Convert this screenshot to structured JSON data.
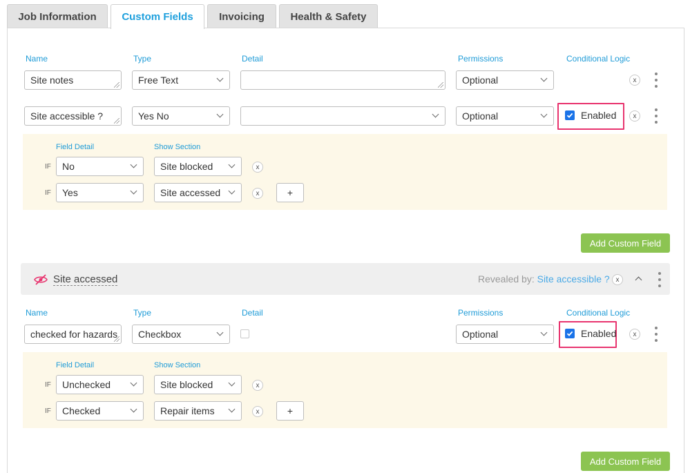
{
  "tabs": [
    "Job Information",
    "Custom Fields",
    "Invoicing",
    "Health & Safety"
  ],
  "columns": {
    "name": "Name",
    "type": "Type",
    "detail": "Detail",
    "permissions": "Permissions",
    "conditional": "Conditional Logic"
  },
  "fields": [
    {
      "name": "Site notes",
      "type": "Free Text",
      "detail": "",
      "permission": "Optional"
    },
    {
      "name": "Site accessible ?",
      "type": "Yes No",
      "detail": "",
      "permission": "Optional",
      "conditional_label": "Enabled"
    }
  ],
  "conditions1": {
    "field_detail_label": "Field Detail",
    "show_section_label": "Show Section",
    "if_label": "IF",
    "rows": [
      {
        "detail": "No",
        "section": "Site blocked"
      },
      {
        "detail": "Yes",
        "section": "Site accessed"
      }
    ],
    "add_label": "+"
  },
  "add_custom_field_label": "Add Custom Field",
  "section": {
    "title": "Site accessed",
    "revealed_by_label": "Revealed by:",
    "revealed_by_field": "Site accessible ?"
  },
  "section_fields": [
    {
      "name": "checked for hazards",
      "type": "Checkbox",
      "permission": "Optional",
      "conditional_label": "Enabled"
    }
  ],
  "conditions2": {
    "field_detail_label": "Field Detail",
    "show_section_label": "Show Section",
    "if_label": "IF",
    "rows": [
      {
        "detail": "Unchecked",
        "section": "Site blocked"
      },
      {
        "detail": "Checked",
        "section": "Repair items"
      }
    ],
    "add_label": "+"
  },
  "colors": {
    "accent": "#1fa0dd",
    "highlight": "#e8336e",
    "green": "#8cc452",
    "cond_bg": "#fdf8e8"
  }
}
